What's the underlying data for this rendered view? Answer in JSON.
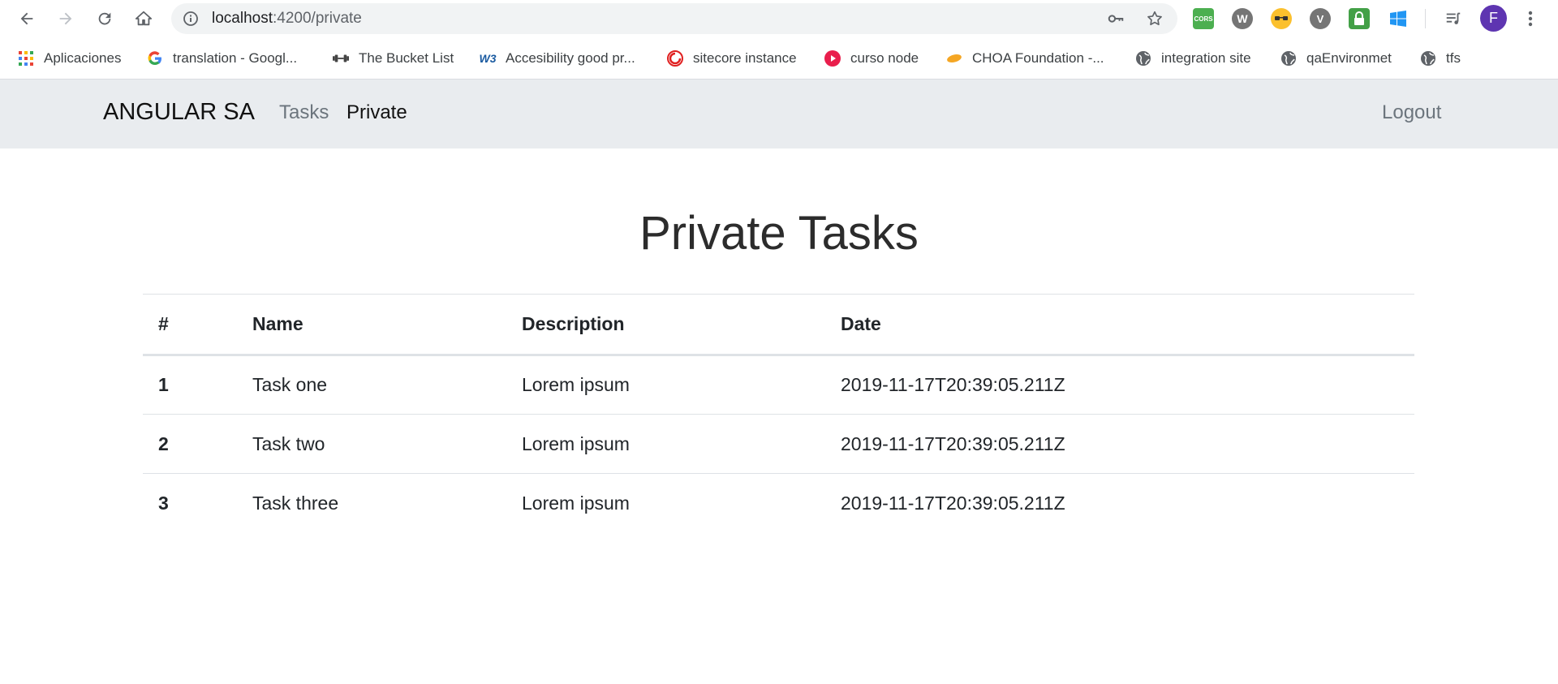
{
  "browser": {
    "url_host": "localhost",
    "url_rest": ":4200/private",
    "profile_initial": "F",
    "bookmarks": [
      {
        "label": "Aplicaciones",
        "icon": "apps-grid-icon"
      },
      {
        "label": "translation - Googl...",
        "icon": "google-icon"
      },
      {
        "label": "The Bucket List",
        "icon": "dumbbell-icon"
      },
      {
        "label": "Accesibility good pr...",
        "icon": "w3c-icon"
      },
      {
        "label": "sitecore instance",
        "icon": "sitecore-icon"
      },
      {
        "label": "curso node",
        "icon": "play-circle-icon"
      },
      {
        "label": "CHOA Foundation -...",
        "icon": "choa-icon"
      },
      {
        "label": "integration site",
        "icon": "globe-icon"
      },
      {
        "label": "qaEnvironmet",
        "icon": "globe-icon"
      },
      {
        "label": "tfs",
        "icon": "globe-icon"
      }
    ],
    "extensions": [
      {
        "name": "cors-extension-icon",
        "label": "CORS",
        "color": "#4caf50"
      },
      {
        "name": "w-extension-icon",
        "label": "W",
        "color": "#757575"
      },
      {
        "name": "glasses-extension-icon",
        "label": "",
        "color": "#fbc02d"
      },
      {
        "name": "v-extension-icon",
        "label": "V",
        "color": "#757575"
      },
      {
        "name": "lock-extension-icon",
        "label": "",
        "color": "#43a047"
      },
      {
        "name": "windows-extension-icon",
        "label": "",
        "color": "#2196f3"
      }
    ]
  },
  "navbar": {
    "brand": "ANGULAR SA",
    "links": [
      {
        "label": "Tasks"
      },
      {
        "label": "Private"
      }
    ],
    "logout_label": "Logout"
  },
  "main": {
    "title": "Private Tasks",
    "table": {
      "columns": [
        "#",
        "Name",
        "Description",
        "Date"
      ],
      "rows": [
        {
          "index": "1",
          "name": "Task one",
          "description": "Lorem ipsum",
          "date": "2019-11-17T20:39:05.211Z"
        },
        {
          "index": "2",
          "name": "Task two",
          "description": "Lorem ipsum",
          "date": "2019-11-17T20:39:05.211Z"
        },
        {
          "index": "3",
          "name": "Task three",
          "description": "Lorem ipsum",
          "date": "2019-11-17T20:39:05.211Z"
        }
      ]
    }
  }
}
